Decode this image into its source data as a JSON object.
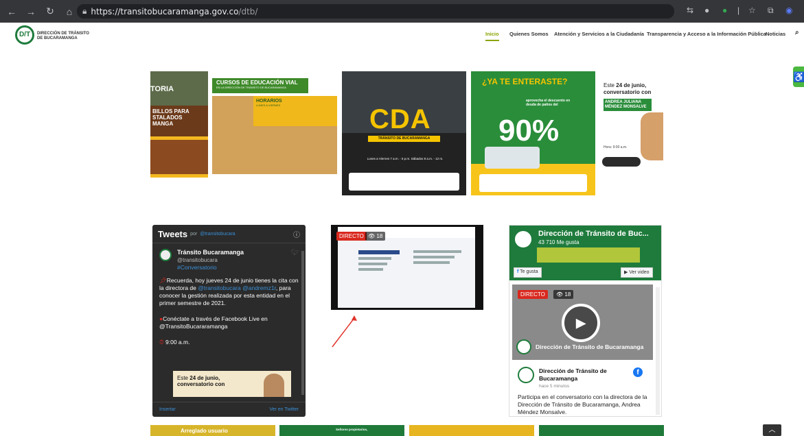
{
  "browser": {
    "url_host": "https://transitobucaramanga.gov.co",
    "url_path": "/dtb/"
  },
  "header": {
    "logo_line1": "DIRECCIÓN DE TRÁNSITO",
    "logo_line2": "DE BUCARAMANGA",
    "logo_mark": "D/T",
    "menu": [
      {
        "label": "Inicio"
      },
      {
        "label": "Quienes Somos"
      },
      {
        "label": "Atención y Servicios a la Ciudadanía"
      },
      {
        "label": "Transparencia y Acceso a la Información Pública"
      },
      {
        "label": "Noticias"
      }
    ]
  },
  "banners": {
    "b1": {
      "lines": [
        "TORIA",
        "BILLOS PARA",
        "STALADOS",
        "MANGA"
      ]
    },
    "b2": {
      "title": "CURSOS DE EDUCACIÓN VIAL",
      "subtitle": "EN LA DIRECCIÓN DE TRÁNSITO DE BUCARAMANGA",
      "horarios": "HORARIOS",
      "days": "LUNES A VIERNES"
    },
    "b3": {
      "title": "CDA",
      "subtitle": "TRÁNSITO DE BUCARAMANGA",
      "schedule": "Lunes a Viernes 7 a.m. - 5 p.m.  Sábados 8 a.m. - 12 m."
    },
    "b4": {
      "title": "¿YA TE ENTERASTE?",
      "percent": "90%",
      "text": "aprovecha el descuento en deuda de patios del"
    },
    "b5": {
      "line1": "Este",
      "date": "24 de junio,",
      "line2": "conversatorio con",
      "name": "ANDREA JULIANA MÉNDEZ MONSALVE",
      "hour": "Hora: 9:00 a.m."
    }
  },
  "twitter": {
    "title": "Tweets",
    "by": "por",
    "by_handle": "@transitobucara",
    "user": "Tránsito Bucaramanga",
    "handle": "@transitobucara",
    "hashtag": "#Conversatorio",
    "text1": "Recuerda, hoy jueves 24 de junio tienes la cita con la directora de",
    "mention1": "@transitobucara",
    "mention2": "@andremz1r",
    "text2": ", para conocer la gestión realizada por esta entidad en el primer semestre de 2021.",
    "text3": "Conéctate a través de Facebook Live en @TransitoBucararamanga",
    "time": "9:00 a.m.",
    "card_line1": "Este",
    "card_date": "24 de junio,",
    "card_line2": "conversatorio con",
    "embed": "Insertar",
    "view_on": "Ver en Twitter"
  },
  "video1": {
    "badge": "DIRECTO",
    "views": "18"
  },
  "facebook": {
    "page_title": "Dirección de Tránsito de Buc...",
    "likes": "43 710 Me gusta",
    "like_button": "Te gusta",
    "watch_button": "Ver video",
    "badge": "DIRECTO",
    "views": "18",
    "video_title": "Dirección de Tránsito de Bucaramanga",
    "post_name": "Dirección de Tránsito de Bucaramanga",
    "post_time": "hace 5 minutos",
    "post_text": "Participa en el conversatorio con la directora de la Dirección de Tránsito de Bucaramanga, Andrea Méndez Monsalve."
  },
  "bottom": {
    "b1_text": "Arreglado usuario",
    "b2_text": "Señores propietarios,"
  },
  "colors": {
    "brand_green": "#1e7b3c",
    "accent": "#8aa400",
    "directo_red": "#d9291f",
    "twitter_blue": "#3a8fd6"
  }
}
